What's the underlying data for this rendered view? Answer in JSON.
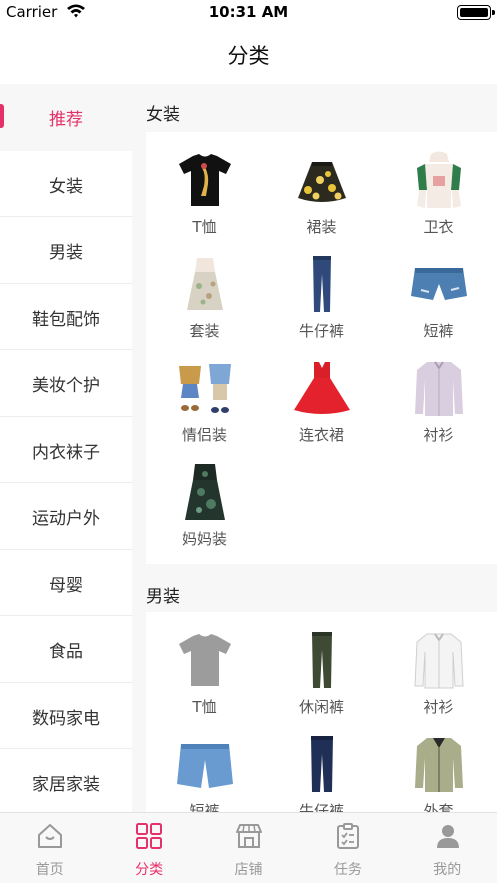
{
  "status_bar": {
    "carrier": "Carrier",
    "time": "10:31 AM",
    "battery_level": 1.0
  },
  "nav": {
    "title": "分类"
  },
  "sidebar": {
    "active_index": 0,
    "items": [
      {
        "label": "推荐"
      },
      {
        "label": "女装"
      },
      {
        "label": "男装"
      },
      {
        "label": "鞋包配饰"
      },
      {
        "label": "美妆个护"
      },
      {
        "label": "内衣袜子"
      },
      {
        "label": "运动户外"
      },
      {
        "label": "母婴"
      },
      {
        "label": "食品"
      },
      {
        "label": "数码家电"
      },
      {
        "label": "家居家装"
      }
    ]
  },
  "sections": [
    {
      "title": "女装",
      "items": [
        {
          "label": "T恤",
          "icon": "black-tshirt-icon"
        },
        {
          "label": "裙装",
          "icon": "floral-skirt-icon"
        },
        {
          "label": "卫衣",
          "icon": "hoodie-icon"
        },
        {
          "label": "套装",
          "icon": "outfit-set-icon"
        },
        {
          "label": "牛仔裤",
          "icon": "jeans-icon"
        },
        {
          "label": "短裤",
          "icon": "denim-shorts-icon"
        },
        {
          "label": "情侣装",
          "icon": "couple-outfit-icon"
        },
        {
          "label": "连衣裙",
          "icon": "red-dress-icon"
        },
        {
          "label": "衬衫",
          "icon": "shirt-icon"
        },
        {
          "label": "妈妈装",
          "icon": "mother-dress-icon"
        }
      ]
    },
    {
      "title": "男装",
      "items": [
        {
          "label": "T恤",
          "icon": "grey-tshirt-icon"
        },
        {
          "label": "休闲裤",
          "icon": "casual-pants-icon"
        },
        {
          "label": "衬衫",
          "icon": "white-shirt-icon"
        },
        {
          "label": "短裤",
          "icon": "men-shorts-icon"
        },
        {
          "label": "牛仔裤",
          "icon": "men-jeans-icon"
        },
        {
          "label": "外套",
          "icon": "jacket-icon"
        }
      ]
    }
  ],
  "tab_bar": {
    "active_index": 1,
    "accent": "#e5316a",
    "items": [
      {
        "label": "首页",
        "icon": "home-icon"
      },
      {
        "label": "分类",
        "icon": "category-grid-icon"
      },
      {
        "label": "店铺",
        "icon": "store-icon"
      },
      {
        "label": "任务",
        "icon": "task-clipboard-icon"
      },
      {
        "label": "我的",
        "icon": "profile-icon"
      }
    ]
  }
}
